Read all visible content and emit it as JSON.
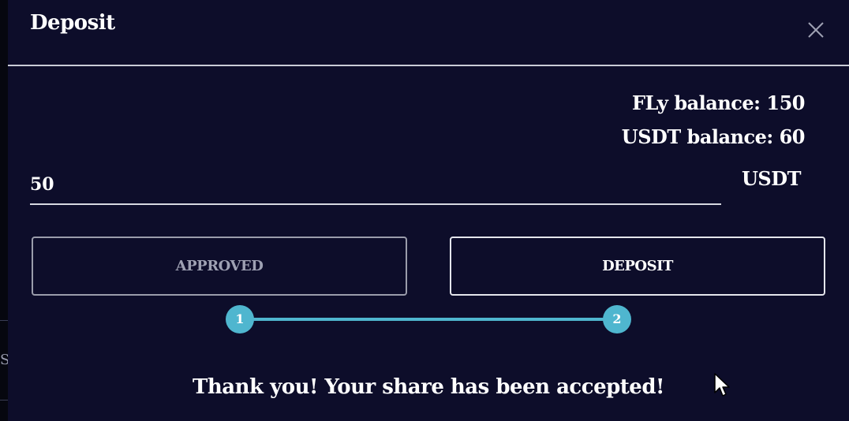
{
  "background": {
    "fragment_text": "S"
  },
  "modal": {
    "title": "Deposit",
    "close_icon": "close-icon"
  },
  "balances": {
    "fly": "FLy balance: 150",
    "usdt": "USDT balance: 60"
  },
  "amount": {
    "value": "50",
    "unit": "USDT"
  },
  "buttons": {
    "approved": "APPROVED",
    "deposit": "DEPOSIT"
  },
  "stepper": {
    "steps": [
      "1",
      "2"
    ],
    "color": "#4fb6cf"
  },
  "message": "Thank you! Your share has been accepted!",
  "colors": {
    "modal_bg": "#0d0d2a",
    "accent": "#4fb6cf",
    "text": "#ffffff"
  }
}
